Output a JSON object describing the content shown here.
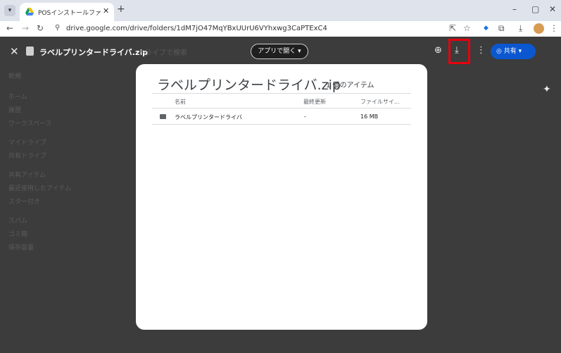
{
  "browser": {
    "tab_title": "POSインストールファイル - Google",
    "url": "drive.google.com/drive/folders/1dM7jO47MqYBxUUrU6VYhxwg3CaPTExC4",
    "icons": {
      "tab_menu": "▾",
      "tab_close": "✕",
      "new_tab": "+",
      "minimize": "–",
      "restore": "▢",
      "close": "✕",
      "back": "←",
      "forward": "→",
      "reload": "↻",
      "site_info": "⚲",
      "install": "⇱",
      "bookmark": "☆",
      "ext1": "◆",
      "extensions": "⧉",
      "downloads": "⤓",
      "menu": "⋮"
    }
  },
  "drive_ghost": {
    "sidebar": [
      "新規",
      "ホーム",
      "履歴",
      "ワークスペース",
      "マイドライブ",
      "共有ドライブ",
      "共有アイテム",
      "最近使用したアイテム",
      "スター付き",
      "スパム",
      "ゴミ箱",
      "保存容量"
    ],
    "search_placeholder": "ドライブで検索"
  },
  "preview_header": {
    "close_icon": "✕",
    "title": "ラベルプリンタードライバ.zip",
    "open_with_label": "アプリで開く ▾",
    "add_to_drive_icon": "⊕",
    "download_icon": "⤓",
    "more_icon": "⋮",
    "share_label": "◎  共有  ▾",
    "gemini_icon": "✦"
  },
  "modal": {
    "title": "ラベルプリンタードライバ.zip",
    "item_count": "1 個のアイテム",
    "columns": {
      "name": "名前",
      "modified": "最終更新",
      "size": "ファイルサイ..."
    },
    "rows": [
      {
        "name": "ラベルプリンタードライバ",
        "modified": "-",
        "size": "16 MB"
      }
    ]
  },
  "colors": {
    "highlight": "#e8000d",
    "share_blue": "#0b57d0"
  }
}
